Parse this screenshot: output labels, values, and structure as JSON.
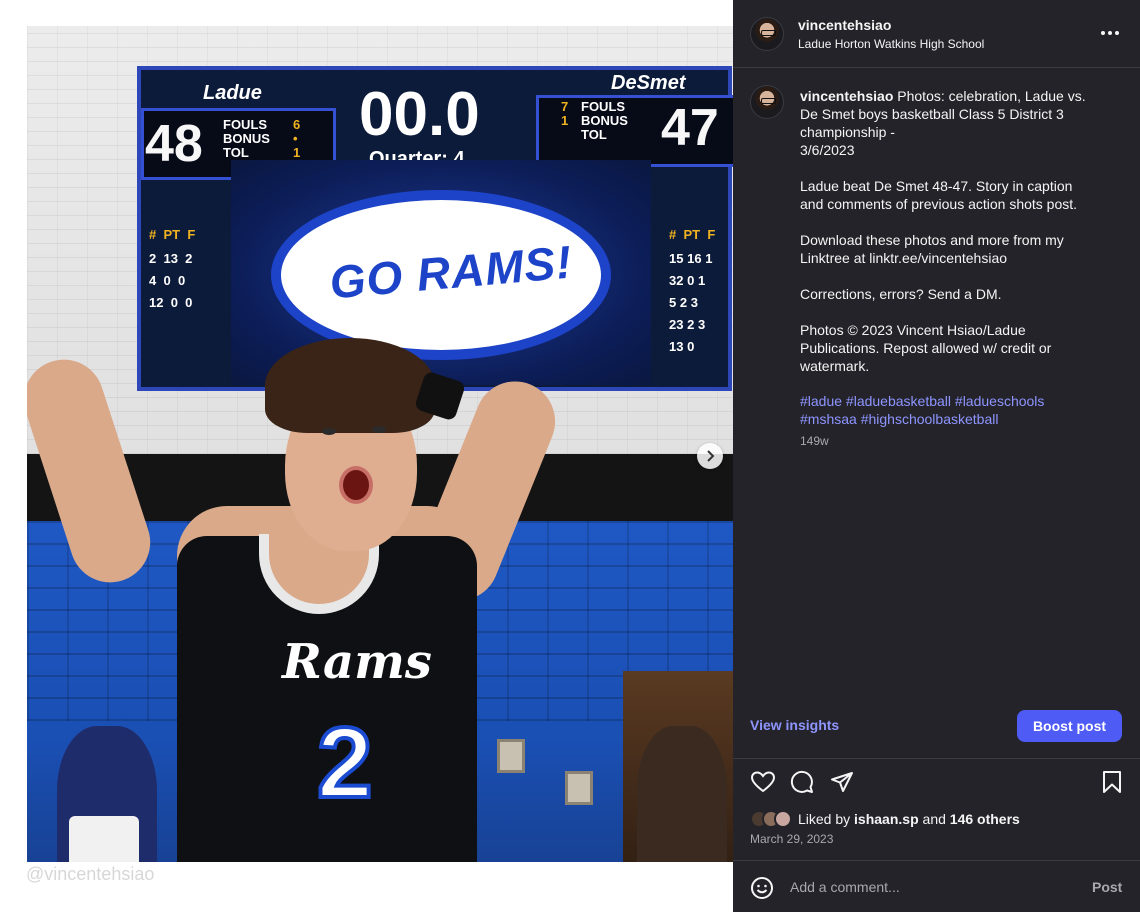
{
  "post": {
    "username": "vincentehsiao",
    "location": "Ladue Horton Watkins High School",
    "caption_username": "vincentehsiao",
    "caption_lines": [
      "Photos: celebration, Ladue vs.",
      "De Smet boys basketball Class 5 District 3",
      "championship -",
      "3/6/2023",
      "",
      "Ladue beat De Smet 48-47. Story in caption",
      "and comments of previous action shots post.",
      "",
      "Download these photos and more from my",
      "Linktree at linktr.ee/vincentehsiao",
      "",
      "Corrections, errors? Send a DM.",
      "",
      "Photos © 2023 Vincent Hsiao/Ladue",
      "Publications. Repost allowed w/ credit or",
      "watermark."
    ],
    "hashtags_line1": "#ladue #laduebasketball #ladueschools",
    "hashtags_line2": "#mshsaa #highschoolbasketball",
    "age": "149w",
    "view_insights": "View insights",
    "boost_post": "Boost post",
    "liked_by_prefix": "Liked by",
    "liked_by_user": "ishaan.sp",
    "liked_by_and": "and",
    "liked_by_others": "146 others",
    "date": "March 29, 2023",
    "comment_placeholder": "Add a comment...",
    "post_button": "Post"
  },
  "photo": {
    "scoreboard": {
      "home_team": "Ladue",
      "home_score": "48",
      "away_team": "DeSmet",
      "away_score": "47",
      "clock": "00.0",
      "quarter": "Quarter: 4",
      "labels": [
        "FOULS",
        "BONUS",
        "TOL"
      ],
      "home_stats": [
        "6",
        "•",
        "1"
      ],
      "away_stats": [
        "7",
        "",
        "1"
      ],
      "slogan": "GO RAMS!",
      "roster_header": [
        "#",
        "PT",
        "F"
      ],
      "home_rows": [
        [
          "2",
          "13",
          "2"
        ],
        [
          "4",
          "0",
          "0"
        ],
        [
          "12",
          "0",
          "0"
        ]
      ],
      "away_rows": [
        [
          "15",
          "16",
          "1"
        ],
        [
          "32",
          "0",
          "1"
        ],
        [
          "5",
          "2",
          "3"
        ],
        [
          "23",
          "2",
          "3"
        ],
        [
          "13",
          "0",
          ""
        ]
      ]
    },
    "jersey_word": "Rams",
    "jersey_number": "2",
    "watermark": "@vincentehsiao"
  },
  "colors": {
    "panel_bg": "#232329",
    "accent_link": "#8e95ff",
    "boost_button": "#4f5bf5",
    "gym_wall_blue": "#1f58c4"
  },
  "icons": {
    "more": "more-horizontal-icon",
    "like": "heart-icon",
    "comment": "comment-bubble-icon",
    "share": "paper-plane-icon",
    "save": "bookmark-icon",
    "emoji": "smiley-icon",
    "next": "chevron-right-icon"
  }
}
